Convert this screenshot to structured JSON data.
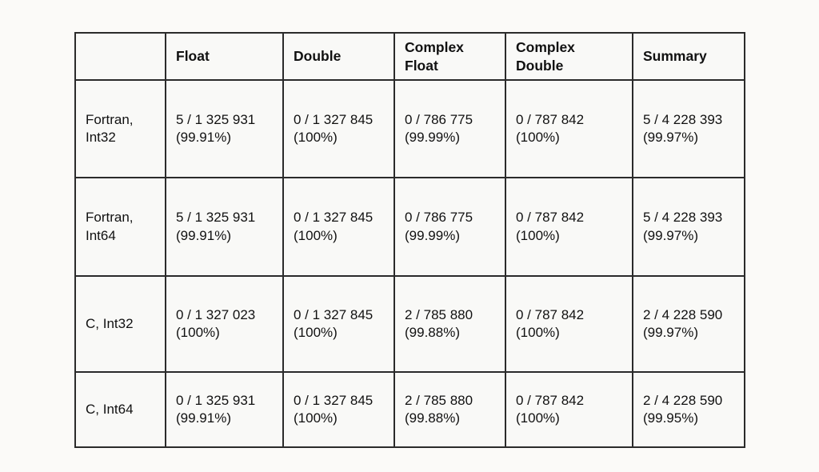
{
  "table": {
    "caption": "",
    "columns": [
      {
        "label": ""
      },
      {
        "label": "Float"
      },
      {
        "label": "Double"
      },
      {
        "label": "Complex\nFloat"
      },
      {
        "label": "Complex\nDouble"
      },
      {
        "label": "Summary"
      }
    ],
    "column_labels": {
      "blank": "",
      "float": "Float",
      "double": "Double",
      "complex_float_line1": "Complex",
      "complex_float_line2": "Float",
      "complex_double_line1": "Complex",
      "complex_double_line2": "Double",
      "summary": "Summary"
    },
    "rows": [
      {
        "label_line1": "Fortran,",
        "label_line2": "Int32",
        "cells": [
          {
            "counts": "5 / 1 325 931",
            "percent": "(99.91%)"
          },
          {
            "counts": "0 / 1 327 845",
            "percent": "(100%)"
          },
          {
            "counts": "0 / 786 775",
            "percent": "(99.99%)"
          },
          {
            "counts": "0 / 787 842",
            "percent": "(100%)"
          },
          {
            "counts": "5 / 4 228 393",
            "percent": "(99.97%)"
          }
        ]
      },
      {
        "label_line1": "Fortran,",
        "label_line2": "Int64",
        "cells": [
          {
            "counts": "5 / 1 325 931",
            "percent": "(99.91%)"
          },
          {
            "counts": "0 / 1 327 845",
            "percent": "(100%)"
          },
          {
            "counts": "0 / 786 775",
            "percent": "(99.99%)"
          },
          {
            "counts": "0 / 787 842",
            "percent": "(100%)"
          },
          {
            "counts": "5 / 4 228 393",
            "percent": "(99.97%)"
          }
        ]
      },
      {
        "label_line1": "C, Int32",
        "label_line2": "",
        "cells": [
          {
            "counts": "0 / 1 327 023",
            "percent": "(100%)"
          },
          {
            "counts": "0 / 1 327 845",
            "percent": "(100%)"
          },
          {
            "counts": "2 / 785 880",
            "percent": "(99.88%)"
          },
          {
            "counts": "0 / 787 842",
            "percent": "(100%)"
          },
          {
            "counts": "2 / 4 228 590",
            "percent": "(99.97%)"
          }
        ]
      },
      {
        "label_line1": "C, Int64",
        "label_line2": "",
        "cells": [
          {
            "counts": "0 / 1 325 931",
            "percent": "(99.91%)"
          },
          {
            "counts": "0 / 1 327 845",
            "percent": "(100%)"
          },
          {
            "counts": "2 / 785 880",
            "percent": "(99.88%)"
          },
          {
            "counts": "0 / 787 842",
            "percent": "(100%)"
          },
          {
            "counts": "2 / 4 228 590",
            "percent": "(99.95%)"
          }
        ]
      }
    ]
  },
  "colors": {
    "page_background": "#fbfaf8",
    "cell_background": "#f9f9f7",
    "border": "#2b2b2b",
    "text": "#111111"
  }
}
